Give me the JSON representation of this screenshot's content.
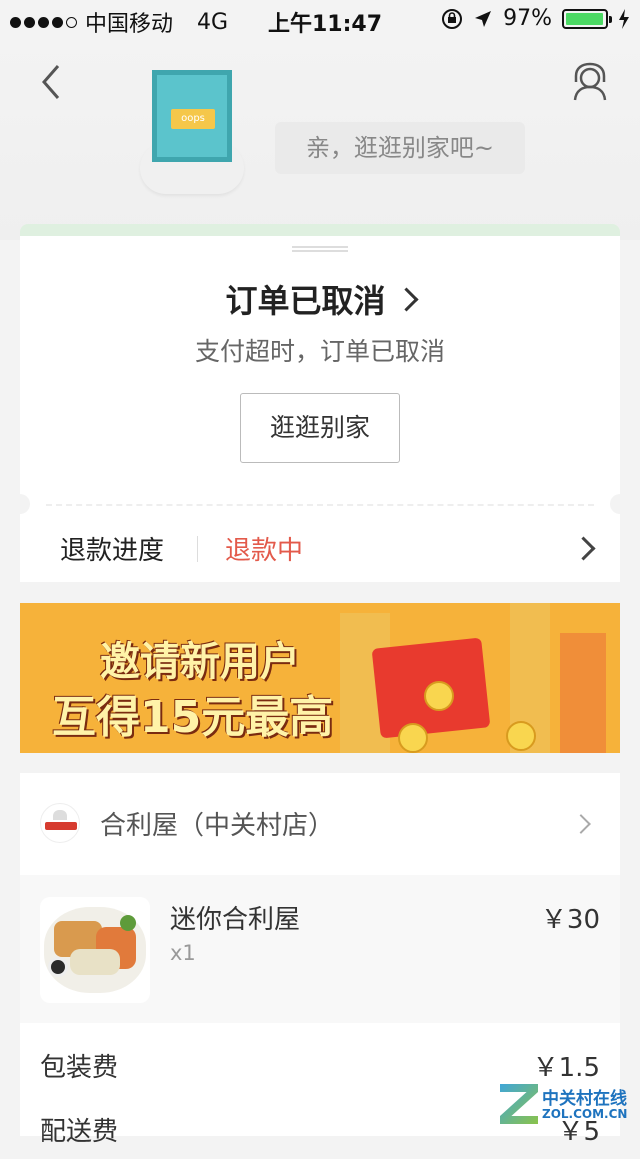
{
  "status_bar": {
    "carrier": "中国移动",
    "network": "4G",
    "time": "上午11:47",
    "battery": "97%",
    "battery_level": 0.97,
    "battery_color": "#4cd964"
  },
  "header": {
    "back_icon": "chevron-left-icon",
    "user_icon": "customer-service-icon",
    "sign_text": "oops",
    "bubble_text": "亲，逛逛别家吧~"
  },
  "order": {
    "title": "订单已取消",
    "subtitle": "支付超时，订单已取消",
    "shop_button": "逛逛别家",
    "refund_label": "退款进度",
    "refund_status": "退款中",
    "refund_status_color": "#e35a4b"
  },
  "banner": {
    "line1": "邀请新用户",
    "line2": "互得15元最高"
  },
  "shop": {
    "name": "合利屋（中关村店）",
    "items": [
      {
        "name": "迷你合利屋",
        "qty": "x1",
        "price": "￥30"
      }
    ],
    "fees": [
      {
        "label": "包装费",
        "value": "￥1.5"
      },
      {
        "label": "配送费",
        "value": "￥5"
      }
    ]
  },
  "watermark": {
    "title": "中关村在线",
    "subtitle": "ZOL.COM.CN"
  }
}
